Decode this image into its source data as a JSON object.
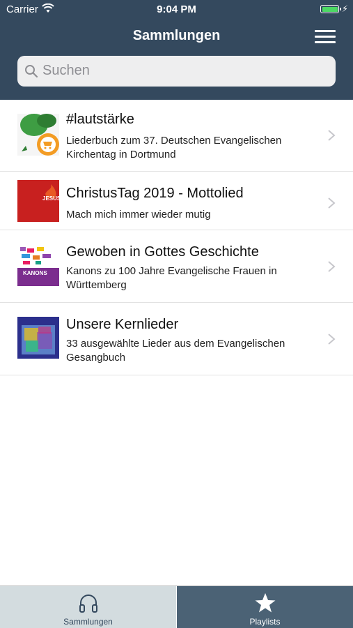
{
  "status": {
    "carrier": "Carrier",
    "time": "9:04 PM"
  },
  "header": {
    "title": "Sammlungen",
    "menu_icon": "hamburger-menu-icon"
  },
  "search": {
    "placeholder": "Suchen",
    "icon": "search-icon"
  },
  "items": [
    {
      "title": "#lautstärke",
      "subtitle": "Liederbuch zum 37. Deutschen Evangelischen Kirchentag in Dortmund"
    },
    {
      "title": "ChristusTag 2019 - Mottolied",
      "subtitle": "Mach mich immer wieder mutig",
      "thumb_text": "JESUS"
    },
    {
      "title": "Gewoben in Gottes Geschichte",
      "subtitle": "Kanons zu 100 Jahre Evangelische Frauen in Württemberg",
      "thumb_text": "KANONS"
    },
    {
      "title": "Unsere Kernlieder",
      "subtitle": "33 ausgewählte Lieder aus dem Evangelischen Gesangbuch"
    }
  ],
  "tabbar": {
    "tabs": [
      {
        "label": "Sammlungen",
        "icon": "headphones-icon",
        "active": true
      },
      {
        "label": "Playlists",
        "icon": "star-icon",
        "active": false
      }
    ]
  },
  "colors": {
    "header": "#34495e",
    "tab_active_bg": "#d3dcdf",
    "tab_inactive_bg": "#4b6275",
    "battery": "#4cd964"
  }
}
